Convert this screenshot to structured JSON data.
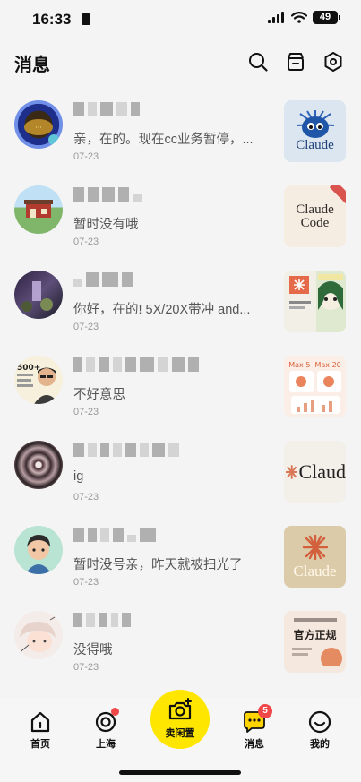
{
  "status_bar": {
    "time": "16:33",
    "battery": "49"
  },
  "header": {
    "title": "消息"
  },
  "messages": [
    {
      "preview": "亲，在的。现在cc业务暂停，...",
      "date": "07-23",
      "thumb_text": "Claude"
    },
    {
      "preview": "暂时没有哦",
      "date": "07-23",
      "thumb_text": "Claude Code"
    },
    {
      "preview": "你好，在的! 5X/20X带冲 and...",
      "date": "07-23",
      "thumb_text": ""
    },
    {
      "preview": "不好意思",
      "date": "07-23",
      "thumb_text": "Max 5  Max 20"
    },
    {
      "preview": "ig",
      "date": "07-23",
      "thumb_text": "Claud"
    },
    {
      "preview": "暂时没号亲，昨天就被扫光了",
      "date": "07-23",
      "thumb_text": "Claude"
    },
    {
      "preview": "没得哦",
      "date": "07-23",
      "thumb_text": "官方正规"
    }
  ],
  "bottom_nav": {
    "home": "首页",
    "city": "上海",
    "sell": "卖闲置",
    "messages": "消息",
    "messages_badge": "5",
    "me": "我的"
  }
}
